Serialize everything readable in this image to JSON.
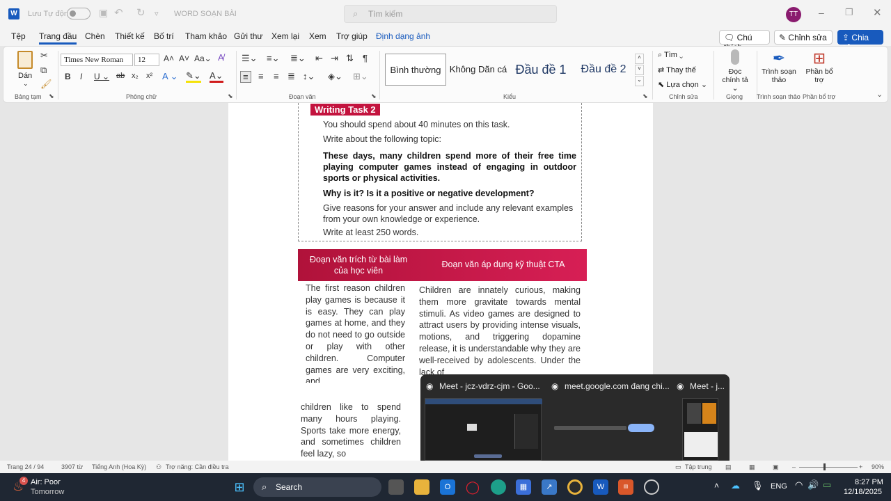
{
  "titlebar": {
    "autosave_label": "Lưu Tự động",
    "doc_title": "WORD SOẠN BÀI",
    "search_placeholder": "Tìm kiếm",
    "user_initials": "TT"
  },
  "menu": {
    "tabs": [
      "Tệp",
      "Trang đầu",
      "Chèn",
      "Thiết kế",
      "Bố trí",
      "Tham khảo",
      "Gửi thư",
      "Xem lại",
      "Xem",
      "Trợ giúp",
      "Định dạng ảnh"
    ],
    "comment_btn": "Chú thích",
    "edit_btn": "Chỉnh sửa",
    "share_btn": "Chia sẻ"
  },
  "ribbon": {
    "paste_label": "Dán",
    "clipboard_group": "Bảng tạm",
    "font_name": "Times New Roman",
    "font_size": "12",
    "font_group": "Phông chữ",
    "paragraph_group": "Đoạn văn",
    "styles": [
      "Bình thường",
      "Không Dãn cá",
      "Đầu đề 1",
      "Đầu đề 2"
    ],
    "styles_group": "Kiểu",
    "find_label": "Tìm",
    "replace_label": "Thay thế",
    "select_label": "Lựa chọn",
    "editing_group": "Chỉnh sửa",
    "dictate_label": "Đọc chính tả",
    "voice_group": "Giọng",
    "editor_label": "Trình soạn thảo",
    "editor_group": "Trình soạn thảo",
    "addins_label": "Phần bổ trợ",
    "addins_group": "Phần bổ trợ"
  },
  "document": {
    "task_label": "Writing Task 2",
    "line1": "You should spend about 40 minutes on this task.",
    "line2": "Write about the following topic:",
    "topic": "These days, many children spend more of their free time playing computer games instead of engaging in outdoor sports or physical activities.",
    "question": "Why is it? Is it a positive or negative development?",
    "instruction": "Give reasons for your answer and include any relevant examples from your own knowledge or experience.",
    "min_words": "Write at least 250 words.",
    "banner_left": "Đoạn văn trích từ bài làm của học viên",
    "banner_right": "Đoạn văn áp dụng kỹ thuật CTA",
    "left_col": "The first reason children play games is because it is easy. They can play games at home, and they do not need to go outside or play with other children. Computer games are very exciting, and",
    "right_col": "Children are innately curious, making them more gravitate towards mental stimuli. As video games are designed to attract users by providing intense visuals, motions, and triggering dopamine release, it is understandable why they are well-received by adolescents. Under the lack of",
    "bottom_col": "children like to spend many hours playing. Sports take more energy, and sometimes children feel lazy, so"
  },
  "popup": {
    "tab1": "Meet - jcz-vdrz-cjm - Goo...",
    "tab2": "meet.google.com đang chi...",
    "tab3": "Meet - j..."
  },
  "status": {
    "page": "Trang 24 / 94",
    "words": "3907 từ",
    "language": "Tiếng Anh (Hoa Kỳ)",
    "accessibility": "Trợ năng: Cần điều tra",
    "focus": "Tập trung",
    "zoom": "90%"
  },
  "taskbar": {
    "weather_title": "Air: Poor",
    "weather_sub": "Tomorrow",
    "weather_badge": "4",
    "search_label": "Search",
    "lang": "ENG",
    "time": "8:27 PM",
    "date": "12/18/2025"
  }
}
